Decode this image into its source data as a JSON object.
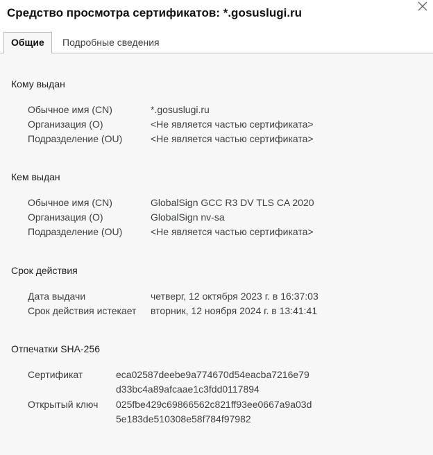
{
  "window": {
    "title": "Средство просмотра сертификатов: *.gosuslugi.ru",
    "close_icon": "close-icon"
  },
  "tabs": [
    {
      "label": "Общие",
      "active": true
    },
    {
      "label": "Подробные сведения",
      "active": false
    }
  ],
  "issued_to": {
    "heading": "Кому выдан",
    "rows": [
      {
        "label": "Обычное имя (CN)",
        "value": "*.gosuslugi.ru"
      },
      {
        "label": "Организация (O)",
        "value": "<Не является частью сертификата>"
      },
      {
        "label": "Подразделение (OU)",
        "value": "<Не является частью сертификата>"
      }
    ]
  },
  "issued_by": {
    "heading": "Кем выдан",
    "rows": [
      {
        "label": "Обычное имя (CN)",
        "value": "GlobalSign GCC R3 DV TLS CA 2020"
      },
      {
        "label": "Организация (O)",
        "value": "GlobalSign nv-sa"
      },
      {
        "label": "Подразделение (OU)",
        "value": "<Не является частью сертификата>"
      }
    ]
  },
  "validity": {
    "heading": "Срок действия",
    "rows": [
      {
        "label": "Дата выдачи",
        "value": "четверг, 12 октября 2023 г. в 16:37:03"
      },
      {
        "label": "Срок действия истекает",
        "value": "вторник, 12 ноября 2024 г. в 13:41:41"
      }
    ]
  },
  "fingerprints": {
    "heading": "Отпечатки SHA-256",
    "rows": [
      {
        "label": "Сертификат",
        "value": "eca02587deebe9a774670d54eacba7216e79d33bc4a89afcaae1c3fdd0117894"
      },
      {
        "label": "Открытый ключ",
        "value": "025fbe429c69866562c821ff93ee0667a9a03d5e183de510308e58f784f97982"
      }
    ]
  }
}
